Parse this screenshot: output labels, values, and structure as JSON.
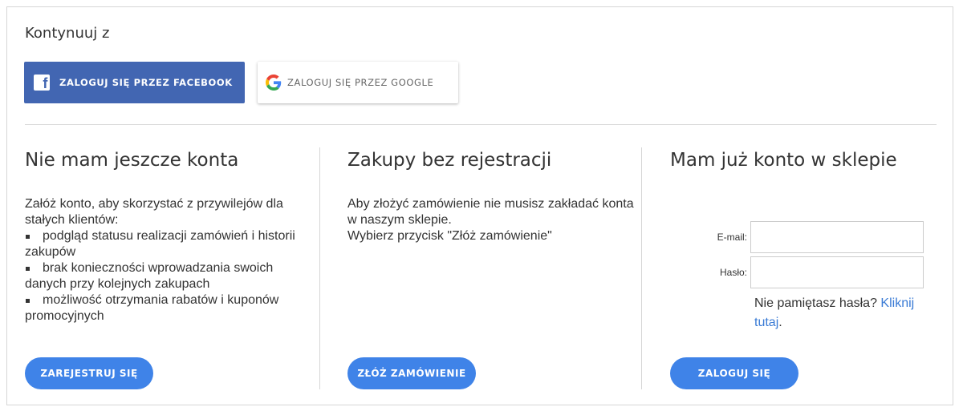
{
  "continue": {
    "title": "Kontynuuj z",
    "facebook_label": "ZALOGUJ SIĘ PRZEZ FACEBOOK",
    "google_label": "ZALOGUJ SIĘ PRZEZ GOOGLE"
  },
  "register": {
    "title": "Nie mam jeszcze konta",
    "intro": "Załóż konto, aby skorzystać z przywilejów dla stałych klientów:",
    "benefits": [
      "podgląd statusu realizacji zamówień i historii zakupów",
      "brak konieczności wprowadzania swoich danych przy kolejnych zakupach",
      "możliwość otrzymania rabatów i kuponów promocyjnych"
    ],
    "button": "ZAREJESTRUJ SIĘ"
  },
  "guest": {
    "title": "Zakupy bez rejestracji",
    "line1": "Aby złożyć zamówienie nie musisz zakładać konta w naszym sklepie.",
    "line2": "Wybierz przycisk \"Złóż zamówienie\"",
    "button": "ZŁÓŻ ZAMÓWIENIE"
  },
  "login": {
    "title": "Mam już konto w sklepie",
    "email_label": "E-mail:",
    "email_value": "",
    "password_label": "Hasło:",
    "password_value": "",
    "forgot_text": "Nie pamiętasz hasła? ",
    "forgot_link": "Kliknij tutaj",
    "forgot_end": ".",
    "button": "ZALOGUJ SIĘ"
  },
  "colors": {
    "facebook": "#4266b2",
    "primary_button": "#3f83e8",
    "link": "#3a7bd5"
  },
  "icons": {
    "facebook": "facebook-icon",
    "google": "google-icon"
  }
}
